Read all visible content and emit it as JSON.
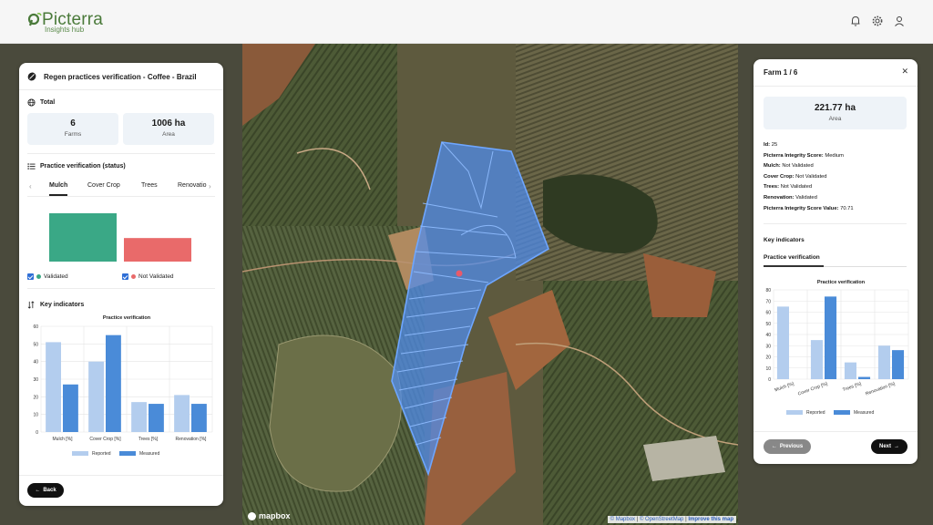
{
  "header": {
    "brand": "Picterra",
    "subtitle": "Insights hub",
    "icons": [
      "bell-icon",
      "gear-icon",
      "user-icon"
    ]
  },
  "left_panel": {
    "title": "Regen practices verification - Coffee - Brazil",
    "total_label": "Total",
    "stats": [
      {
        "value": "6",
        "unit": "Farms"
      },
      {
        "value": "1006 ha",
        "unit": "Area"
      }
    ],
    "practice_label": "Practice verification (status)",
    "tabs": [
      "Mulch",
      "Cover Crop",
      "Trees",
      "Renovatio"
    ],
    "active_tab": "Mulch",
    "status_bars": {
      "validated": 0.78,
      "not_validated": 0.38
    },
    "legend": {
      "validated": "Validated",
      "not_validated": "Not Validated"
    },
    "key_indicators": "Key indicators",
    "back_label": "Back"
  },
  "right_panel": {
    "title": "Farm 1 / 6",
    "area_value": "221.77 ha",
    "area_unit": "Area",
    "props": [
      {
        "k": "Id:",
        "v": "25"
      },
      {
        "k": "Picterra Integrity Score:",
        "v": "Medium"
      },
      {
        "k": "Mulch:",
        "v": "Not Validated"
      },
      {
        "k": "Cover Crop:",
        "v": "Not Validated"
      },
      {
        "k": "Trees:",
        "v": "Not Validated"
      },
      {
        "k": "Renovation:",
        "v": "Validated"
      },
      {
        "k": "Picterra Integrity Score Value:",
        "v": "70.71"
      }
    ],
    "key_indicators": "Key indicators",
    "tab": "Practice verification",
    "prev_label": "Previous",
    "next_label": "Next"
  },
  "map": {
    "logo": "mapbox",
    "attribution_mapbox": "© Mapbox",
    "attribution_osm": "© OpenStreetMap",
    "attribution_improve": "Improve this map"
  },
  "colors": {
    "reported": "#b3cdee",
    "measured": "#4a8bd8",
    "validated": "#3aa886",
    "not_validated": "#e96a6a",
    "accent": "#2f6fd6"
  },
  "chart_data": [
    {
      "type": "bar",
      "title": "Practice verification",
      "categories": [
        "Mulch [%]",
        "Cover Crop [%]",
        "Trees [%]",
        "Renovation [%]"
      ],
      "series": [
        {
          "name": "Reported",
          "values": [
            51,
            40,
            17,
            21
          ]
        },
        {
          "name": "Measured",
          "values": [
            27,
            55,
            16,
            16
          ]
        }
      ],
      "ylim": [
        0,
        60
      ],
      "yticks": [
        0,
        10,
        20,
        30,
        40,
        50,
        60
      ],
      "grid": true,
      "legend": "bottom"
    },
    {
      "type": "bar",
      "title": "Practice verification",
      "categories": [
        "Mulch [%]",
        "Cover Crop [%]",
        "Trees [%]",
        "Renovation [%]"
      ],
      "series": [
        {
          "name": "Reported",
          "values": [
            65,
            35,
            15,
            30
          ]
        },
        {
          "name": "Measured",
          "values": [
            0,
            74,
            2,
            26
          ]
        }
      ],
      "ylim": [
        0,
        80
      ],
      "yticks": [
        0,
        10,
        20,
        30,
        40,
        50,
        60,
        70,
        80
      ],
      "grid": true,
      "legend": "bottom"
    }
  ]
}
